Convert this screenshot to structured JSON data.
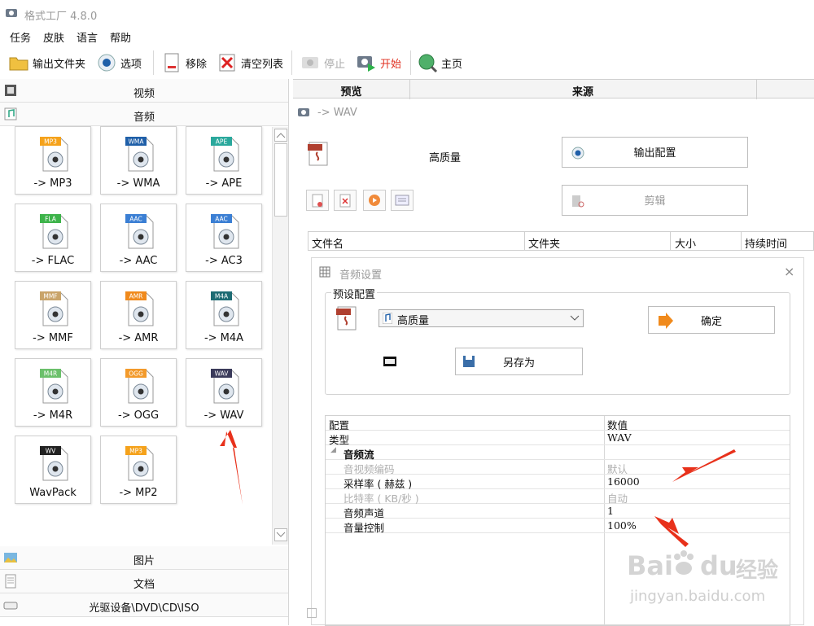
{
  "window": {
    "title": "格式工厂 4.8.0"
  },
  "menu": [
    "任务",
    "皮肤",
    "语言",
    "帮助"
  ],
  "toolbar": {
    "output_folder": "输出文件夹",
    "options": "选项",
    "remove": "移除",
    "clear_list": "清空列表",
    "stop": "停止",
    "start": "开始",
    "home": "主页"
  },
  "left": {
    "categories_top": [
      "视频",
      "音频"
    ],
    "categories_bottom": [
      "图片",
      "文档",
      "光驱设备\\DVD\\CD\\ISO"
    ],
    "tiles": [
      {
        "label": "-> MP3",
        "badge": "MP3",
        "badge_color": "#f5a21b"
      },
      {
        "label": "-> WMA",
        "badge": "WMA",
        "badge_color": "#1f5fa8"
      },
      {
        "label": "-> APE",
        "badge": "APE",
        "badge_color": "#2aa89c"
      },
      {
        "label": "-> FLAC",
        "badge": "FLA",
        "badge_color": "#3db34a"
      },
      {
        "label": "-> AAC",
        "badge": "AAC",
        "badge_color": "#3b7fd4"
      },
      {
        "label": "-> AC3",
        "badge": "AAC",
        "badge_color": "#3b7fd4"
      },
      {
        "label": "-> MMF",
        "badge": "MMF",
        "badge_color": "#c9a46a"
      },
      {
        "label": "-> AMR",
        "badge": "AMR",
        "badge_color": "#f08a1c"
      },
      {
        "label": "-> M4A",
        "badge": "M4A",
        "badge_color": "#1d6b73"
      },
      {
        "label": "-> M4R",
        "badge": "M4R",
        "badge_color": "#6bc06b"
      },
      {
        "label": "-> OGG",
        "badge": "OGG",
        "badge_color": "#f39a2b"
      },
      {
        "label": "-> WAV",
        "badge": "WAV",
        "badge_color": "#3a3a5a"
      },
      {
        "label": "WavPack",
        "badge": "WV",
        "badge_color": "#222222"
      },
      {
        "label": "-> MP2",
        "badge": "MP3",
        "badge_color": "#f5a21b"
      }
    ]
  },
  "right": {
    "header_preview": "预览",
    "header_source": "来源",
    "task_title": "-> WAV",
    "quality": "高质量",
    "output_config_btn": "输出配置",
    "clip_btn": "剪辑",
    "filelist_headers": [
      "文件名",
      "文件夹",
      "大小",
      "持续时间"
    ]
  },
  "dialog": {
    "title": "音频设置",
    "close": "×",
    "preset_legend": "预设配置",
    "preset_value": "高质量",
    "ok_btn": "确定",
    "save_as_btn": "另存为",
    "props_header_k": "配置",
    "props_header_v": "数值",
    "rows": [
      {
        "k": "类型",
        "v": "WAV",
        "disabled": false,
        "group": false
      },
      {
        "k": "音频流",
        "v": "",
        "disabled": false,
        "group": true
      },
      {
        "k": "音视频编码",
        "v": "默认",
        "disabled": true,
        "group": false
      },
      {
        "k": "采样率 ( 赫兹 )",
        "v": "16000",
        "disabled": false,
        "group": false
      },
      {
        "k": "比特率 ( KB/秒 )",
        "v": "自动",
        "disabled": true,
        "group": false
      },
      {
        "k": "音频声道",
        "v": "1",
        "disabled": false,
        "group": false
      },
      {
        "k": "音量控制",
        "v": "100%",
        "disabled": false,
        "group": false
      }
    ]
  },
  "watermark": {
    "brand": "Bai",
    "brand2": "du",
    "cn": "经验",
    "url": "jingyan.baidu.com"
  },
  "colors": {
    "arrow": "#e8311b",
    "accent": "#1f5fa8"
  }
}
